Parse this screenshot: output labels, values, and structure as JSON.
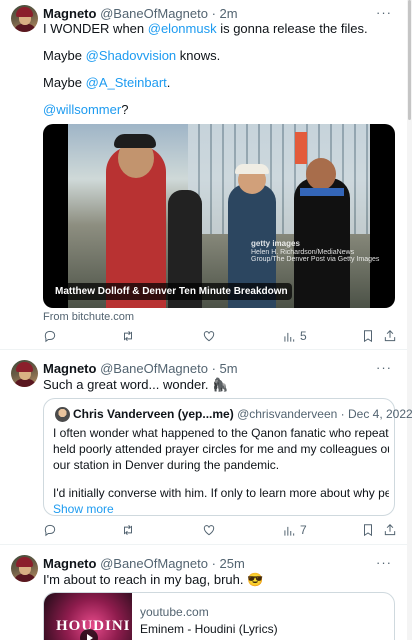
{
  "tweets": [
    {
      "name": "Magneto",
      "handle": "@BaneOfMagneto",
      "dot": " · ",
      "time": "2m",
      "more": "···",
      "lines": {
        "l1_pre": "I WONDER when ",
        "l1_mention": "@elonmusk",
        "l1_post": " is gonna release the files.",
        "l2_mention": "@Shadovvision",
        "l2_pre": "Maybe ",
        "l2_post": " knows.",
        "l3_pre": "Maybe ",
        "l3_mention": "@A_Steinbart",
        "l3_post": ".",
        "l4_mention": "@willsommer",
        "l4_post": "?"
      },
      "media": {
        "caption": "Matthew Dolloff & Denver Ten Minute Breakdown",
        "watermark_brand": "getty images",
        "watermark_line1": "Helen H. Richardson/MediaNews",
        "watermark_line2": "Group/The Denver Post via Getty Images"
      },
      "source": "From bitchute.com",
      "stats": {
        "views": "5"
      }
    },
    {
      "name": "Magneto",
      "handle": "@BaneOfMagneto",
      "dot": " · ",
      "time": "5m",
      "more": "···",
      "text": "Such a great word... wonder. 🦍",
      "quote": {
        "name": "Chris Vanderveen (yep...me)",
        "handle": "@chrisvanderveen",
        "dot": " · ",
        "date": "Dec 4, 2022",
        "lines": [
          "I often wonder what happened to the Qanon fanatic who repeatedly",
          "held poorly attended prayer circles for me and my colleagues outside",
          "our station in Denver during the pandemic.",
          "I'd initially converse with him.  If only to learn more about why people ..."
        ],
        "show_more": "Show more"
      },
      "stats": {
        "views": "7"
      }
    },
    {
      "name": "Magneto",
      "handle": "@BaneOfMagneto",
      "dot": " · ",
      "time": "25m",
      "more": "···",
      "text": "I'm about to reach in my bag, bruh. 😎",
      "card": {
        "thumb_word": "HOUDINI",
        "site": "youtube.com",
        "title": "Eminem - Houdini (Lyrics)"
      }
    }
  ],
  "colors": {
    "link": "#1d9bf0",
    "muted": "#536471",
    "text": "#0f1419"
  },
  "icons": [
    "reply-icon",
    "retweet-icon",
    "like-icon",
    "views-icon",
    "bookmark-icon",
    "share-icon"
  ]
}
